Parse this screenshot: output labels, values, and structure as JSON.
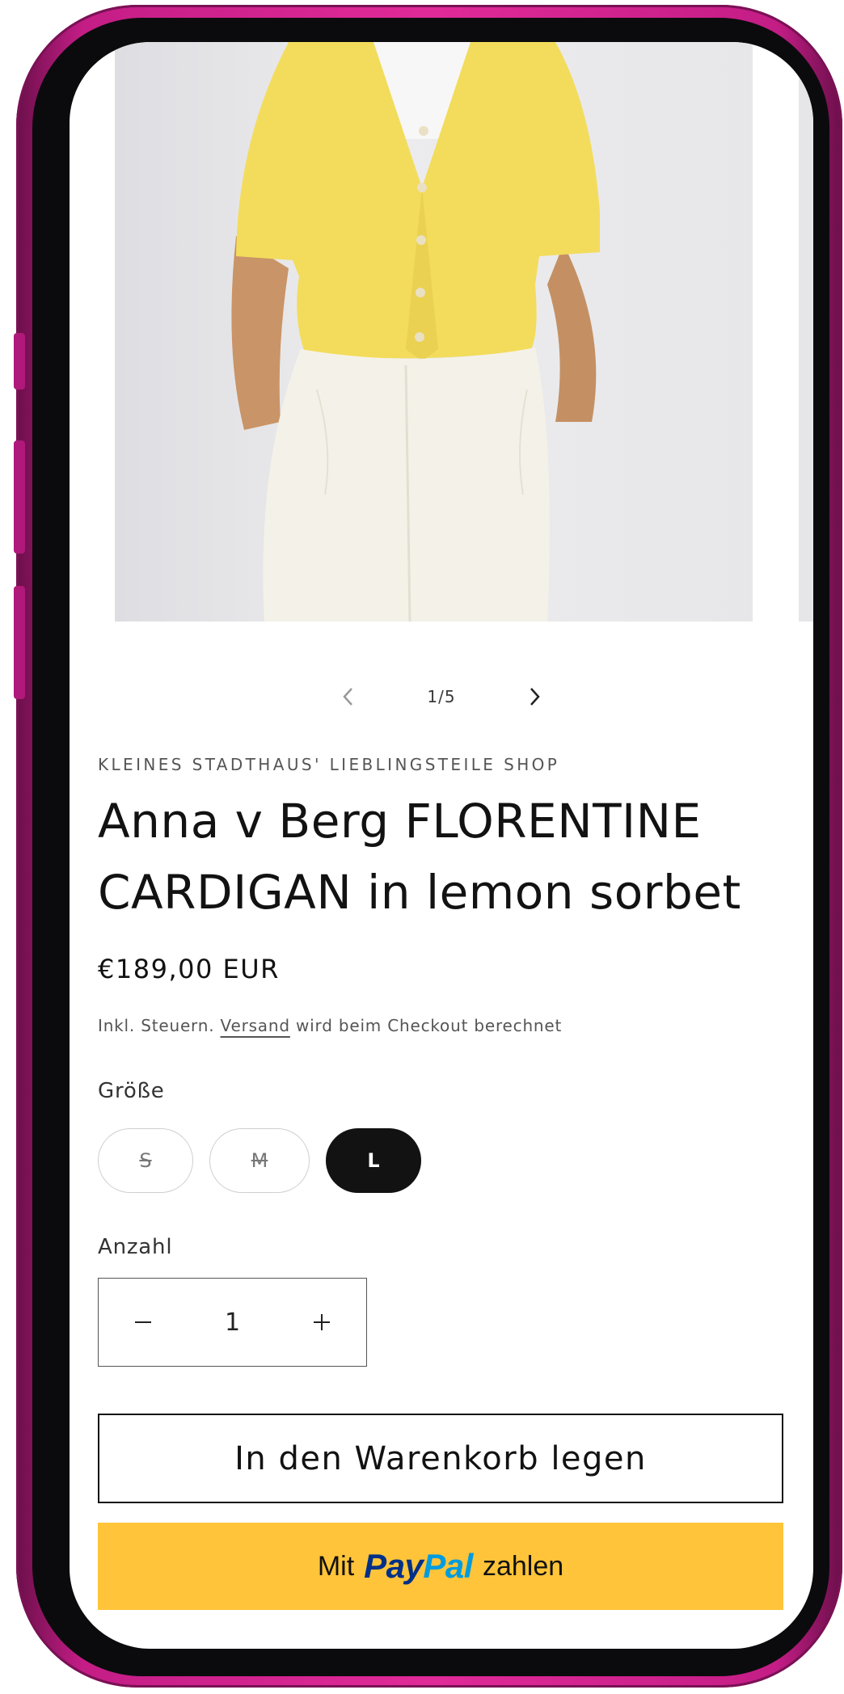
{
  "gallery": {
    "counter": "1/5",
    "prev_icon": "chevron-left-icon",
    "next_icon": "chevron-right-icon"
  },
  "product": {
    "vendor": "KLEINES STADTHAUS' LIEBLINGSTEILE SHOP",
    "title": "Anna v Berg FLORENTINE CARDIGAN in lemon sorbet",
    "price": "€189,00 EUR",
    "tax_prefix": "Inkl. Steuern.",
    "shipping_link": "Versand",
    "tax_suffix": "wird beim Checkout berechnet"
  },
  "size": {
    "label": "Größe",
    "options": [
      {
        "label": "S",
        "available": false,
        "selected": false
      },
      {
        "label": "M",
        "available": false,
        "selected": false
      },
      {
        "label": "L",
        "available": true,
        "selected": true
      }
    ]
  },
  "quantity": {
    "label": "Anzahl",
    "value": "1",
    "minus_icon": "minus-icon",
    "plus_icon": "plus-icon"
  },
  "actions": {
    "add_to_cart": "In den Warenkorb legen",
    "paypal_prefix": "Mit",
    "paypal_brand_1": "Pay",
    "paypal_brand_2": "Pal",
    "paypal_suffix": "zahlen"
  },
  "colors": {
    "frame": "#e02a98",
    "cardigan": "#f3dc5c",
    "paypal_bg": "#ffc439",
    "selected_pill": "#121212"
  }
}
